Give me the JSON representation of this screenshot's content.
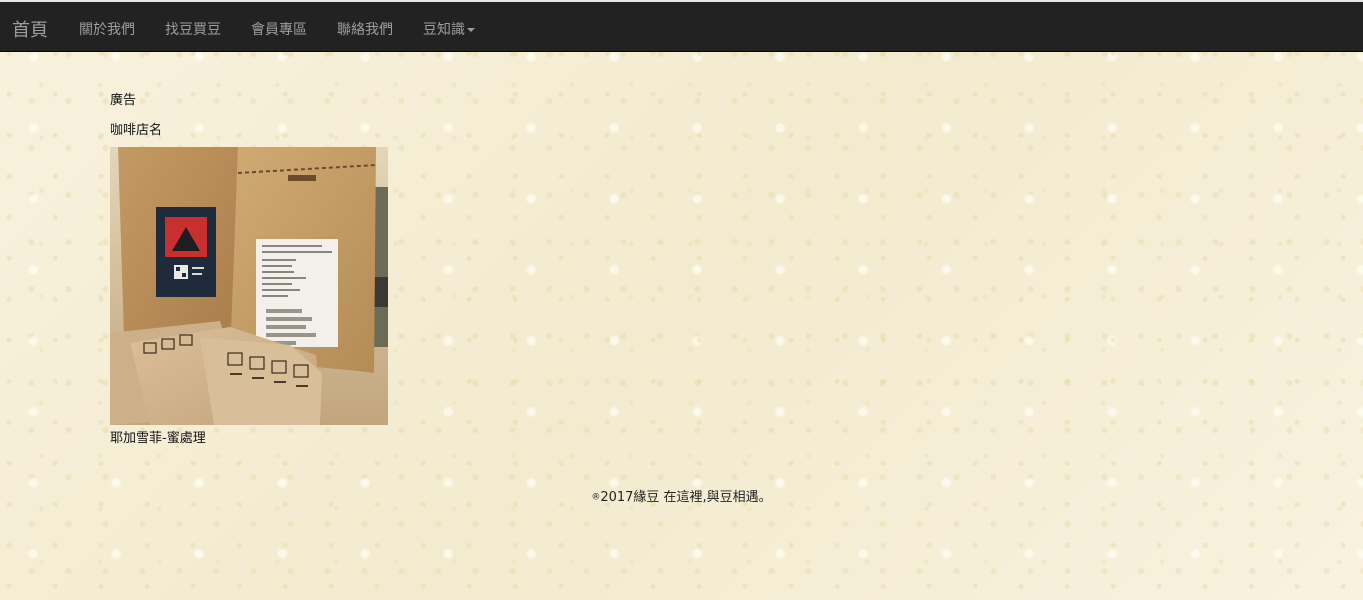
{
  "navbar": {
    "brand": "首頁",
    "items": [
      {
        "label": "關於我們"
      },
      {
        "label": "找豆買豆"
      },
      {
        "label": "會員專區"
      },
      {
        "label": "聯絡我們"
      },
      {
        "label": "豆知識"
      }
    ]
  },
  "main": {
    "ad_label": "廣告",
    "shop_name": "咖啡店名",
    "product": {
      "image_alt": "coffee bean bags photo",
      "bag_label_lines": [
        "產地名稱: 耶加雪菲 蜜處理"
      ],
      "name": "耶加雪菲-蜜處理"
    }
  },
  "footer": {
    "symbol": "®",
    "text": "2017緣豆 在這裡,與豆相遇。"
  },
  "colors": {
    "navbar_bg": "#222222",
    "nav_text": "#9d9d9d",
    "page_bg": "#f6efd8"
  }
}
